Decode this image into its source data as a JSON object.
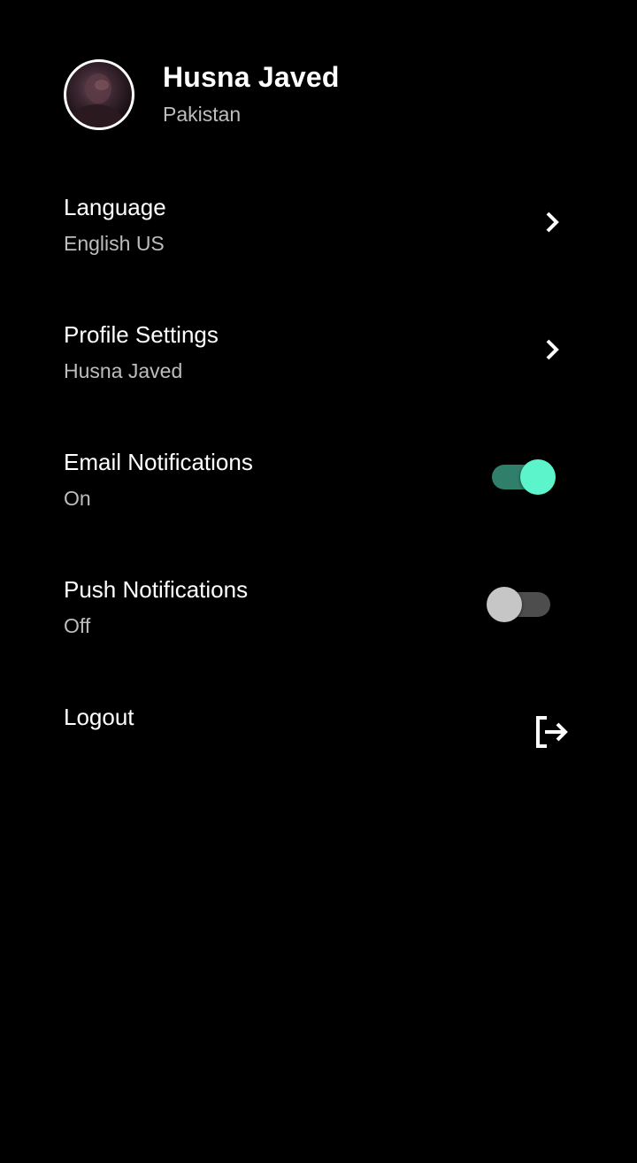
{
  "profile": {
    "name": "Husna Javed",
    "country": "Pakistan",
    "avatar_icon": "user-photo"
  },
  "settings": {
    "language": {
      "title": "Language",
      "value": "English US",
      "icon": "chevron-right-icon"
    },
    "profile_settings": {
      "title": "Profile Settings",
      "value": "Husna Javed",
      "icon": "chevron-right-icon"
    },
    "email_notifications": {
      "title": "Email Notifications",
      "value": "On",
      "enabled": true
    },
    "push_notifications": {
      "title": "Push Notifications",
      "value": "Off",
      "enabled": false
    },
    "logout": {
      "title": "Logout",
      "icon": "logout-icon"
    }
  },
  "colors": {
    "background": "#000000",
    "toggle_on_thumb": "#5cf5cb",
    "toggle_on_track": "#2f7f6a",
    "toggle_off_thumb": "#c6c6c6",
    "toggle_off_track": "#4d4d4d",
    "secondary_text": "#bdbdbd"
  }
}
